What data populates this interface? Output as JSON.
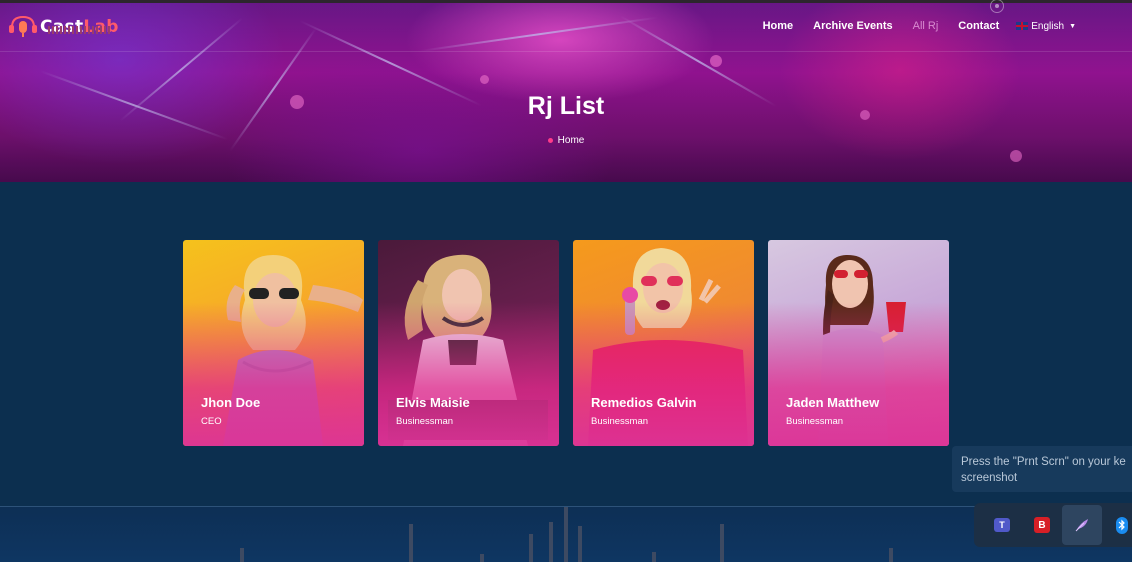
{
  "brand": {
    "name_part1": "Cast",
    "name_part2": "Lab"
  },
  "nav": {
    "items": [
      {
        "label": "Home"
      },
      {
        "label": "Archive Events"
      },
      {
        "label": "All Rj",
        "active": true
      },
      {
        "label": "Contact"
      }
    ],
    "language": "English"
  },
  "hero": {
    "title": "Rj List",
    "breadcrumb": "Home"
  },
  "cards": [
    {
      "name": "Jhon Doe",
      "role": "CEO"
    },
    {
      "name": "Elvis Maisie",
      "role": "Businessman"
    },
    {
      "name": "Remedios Galvin",
      "role": "Businessman"
    },
    {
      "name": "Jaden Matthew",
      "role": "Businessman"
    }
  ],
  "toast": {
    "line1": "Press the \"Prnt Scrn\" on your ke",
    "line2": "screenshot"
  },
  "tray": {
    "icons": [
      "teams-icon",
      "red-app-icon",
      "feather-icon",
      "bluetooth-icon"
    ],
    "teams_glyph": "T",
    "red_glyph": "B"
  },
  "colors": {
    "page_bg": "#0c2f4f",
    "accent_pink": "#e0339a",
    "nav_active": "#d88bd0",
    "brand_red": "#ff5a6a"
  }
}
